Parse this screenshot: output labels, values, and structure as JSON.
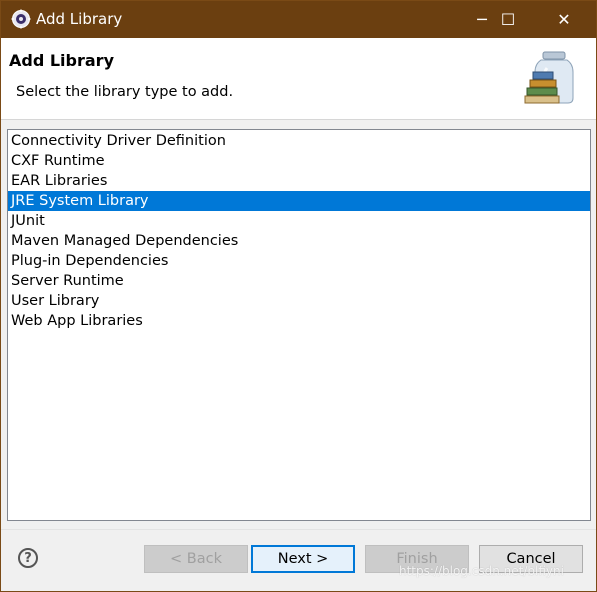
{
  "window": {
    "title": "Add Library",
    "titlebar_color": "#6b3f10",
    "controls": {
      "minimize": "─",
      "maximize": "☐",
      "close": "✕"
    }
  },
  "header": {
    "title": "Add Library",
    "subtitle": "Select the library type to add."
  },
  "library_types": [
    {
      "label": "Connectivity Driver Definition",
      "selected": false
    },
    {
      "label": "CXF Runtime",
      "selected": false
    },
    {
      "label": "EAR Libraries",
      "selected": false
    },
    {
      "label": "JRE System Library",
      "selected": true
    },
    {
      "label": "JUnit",
      "selected": false
    },
    {
      "label": "Maven Managed Dependencies",
      "selected": false
    },
    {
      "label": "Plug-in Dependencies",
      "selected": false
    },
    {
      "label": "Server Runtime",
      "selected": false
    },
    {
      "label": "User Library",
      "selected": false
    },
    {
      "label": "Web App Libraries",
      "selected": false
    }
  ],
  "footer": {
    "help_glyph": "?",
    "back_label": "< Back",
    "next_label": "Next >",
    "finish_label": "Finish",
    "cancel_label": "Cancel"
  },
  "watermark": "https://blog.csdn.net/blfiyni",
  "colors": {
    "selection": "#0078d7",
    "default_button_border": "#0078d7"
  }
}
